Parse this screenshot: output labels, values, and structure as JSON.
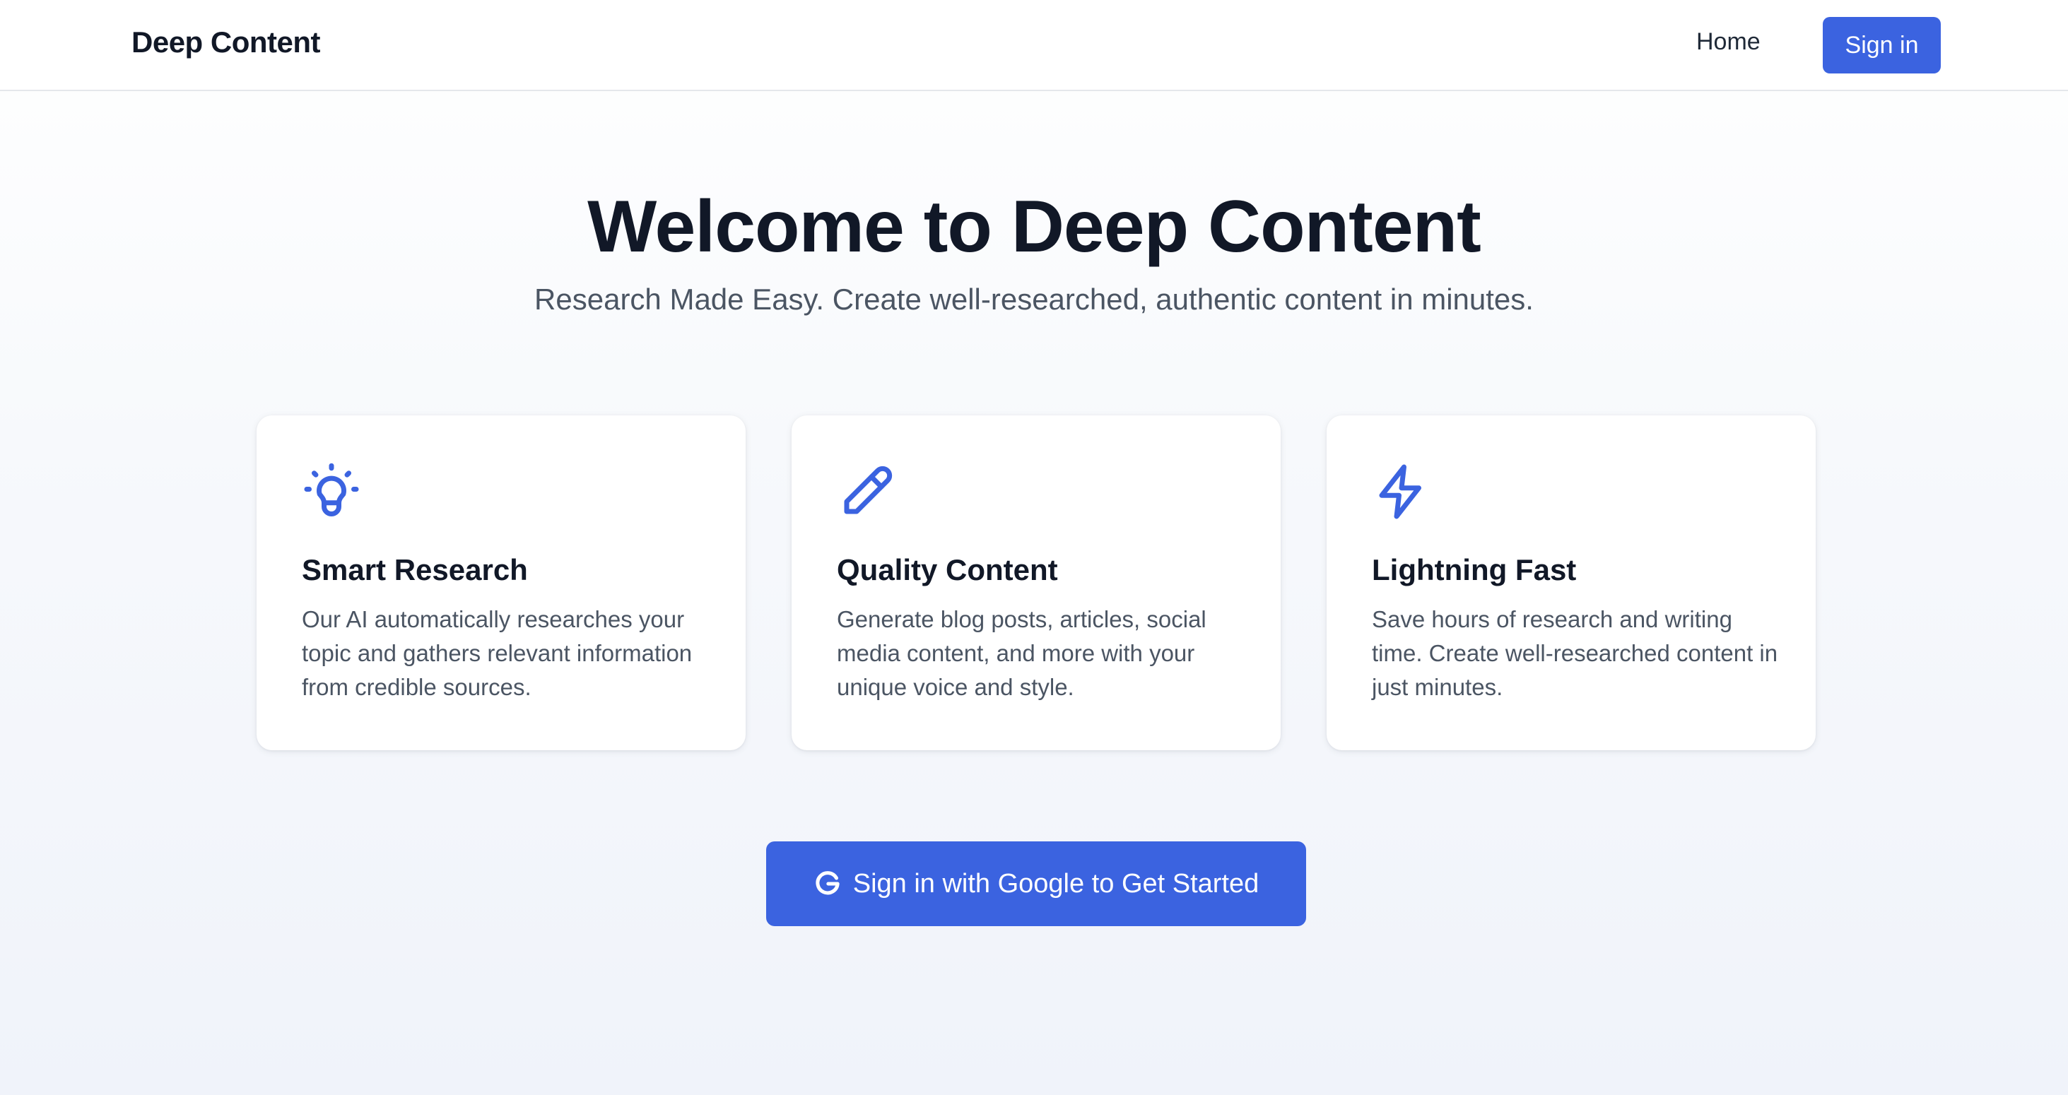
{
  "nav": {
    "brand": "Deep Content",
    "home_label": "Home",
    "signin_label": "Sign in"
  },
  "hero": {
    "title": "Welcome to Deep Content",
    "subtitle": "Research Made Easy. Create well-researched, authentic content in minutes."
  },
  "features": [
    {
      "icon": "lightbulb-icon",
      "title": "Smart Research",
      "description": "Our AI automatically researches your topic and gathers relevant information from credible sources."
    },
    {
      "icon": "pencil-icon",
      "title": "Quality Content",
      "description": "Generate blog posts, articles, social media content, and more with your unique voice and style."
    },
    {
      "icon": "lightning-icon",
      "title": "Lightning Fast",
      "description": "Save hours of research and writing time. Create well-researched content in just minutes."
    }
  ],
  "cta": {
    "icon": "google-icon",
    "label": "Sign in with Google to Get Started"
  },
  "colors": {
    "accent": "#3b63e0",
    "heading": "#111827",
    "body_text": "#4b5563"
  }
}
